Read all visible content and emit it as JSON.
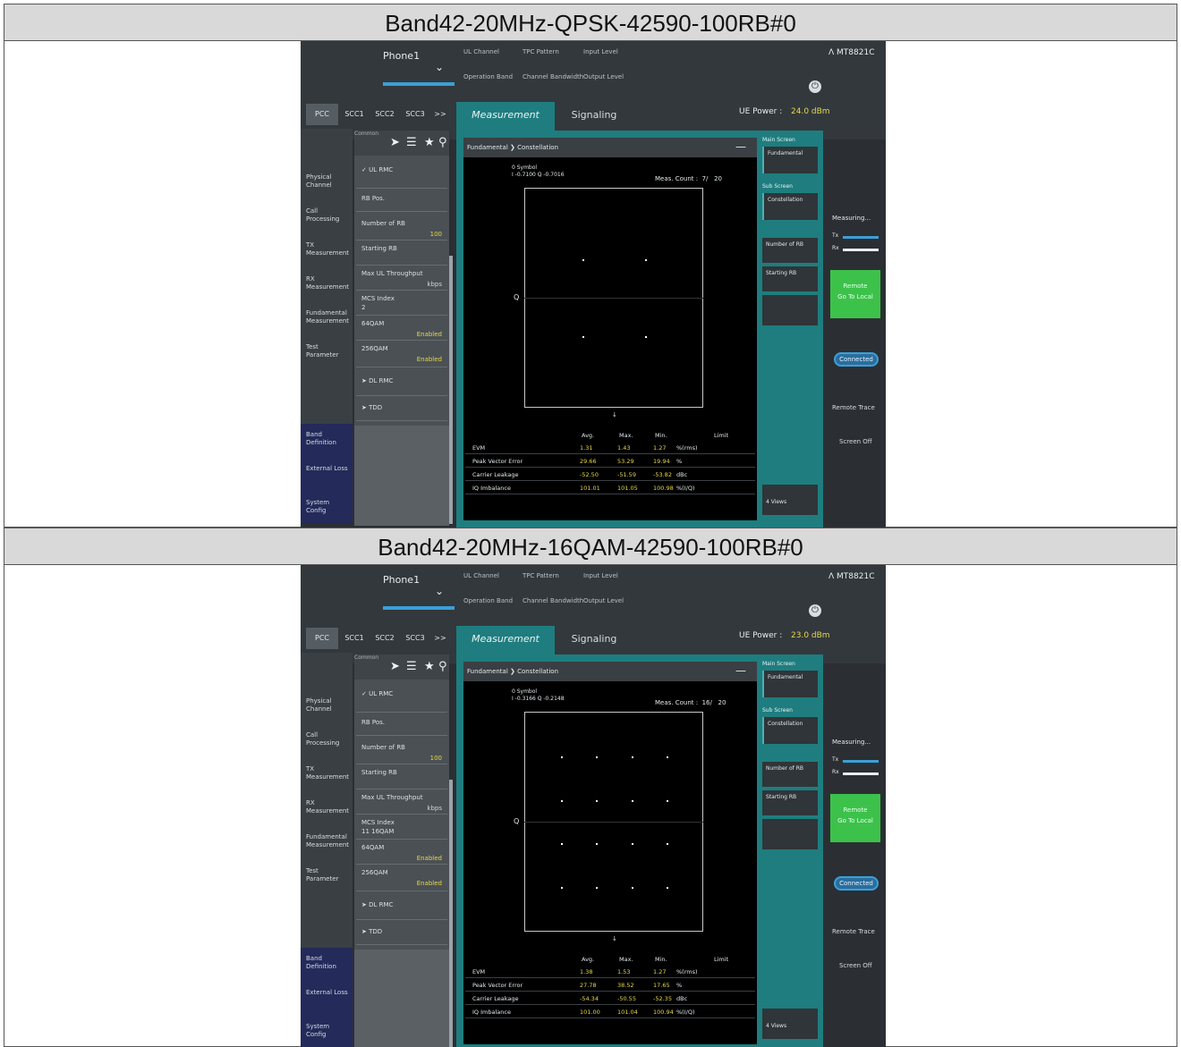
{
  "screens": [
    {
      "header": "Band42-20MHz-QPSK-42590-100RB#0",
      "phone": "Phone1",
      "params": {
        "ul_channel_label": "UL Channel",
        "tpc_pattern_label": "TPC Pattern",
        "input_level_label": "Input Level",
        "operation_band_label": "Operation Band",
        "channel_bandwidth_label": "Channel Bandwidth",
        "output_level_label": "Output Level"
      },
      "brand": "MT8821C",
      "tabs": [
        "PCC",
        "SCC1",
        "SCC2",
        "SCC3",
        ">>"
      ],
      "main_tabs": [
        "Measurement",
        "Signaling"
      ],
      "ue_power_label": "UE Power :",
      "ue_power_value": "24.0 dBm",
      "nav": [
        "Physical Channel",
        "Call Processing",
        "TX Measurement",
        "RX Measurement",
        "Fundamental Measurement",
        "Test Parameter",
        "Band Definition",
        "External Loss",
        "System Config"
      ],
      "common_label": "Common",
      "panel2": {
        "ul_rmc": "UL RMC",
        "rb_pos": "RB Pos.",
        "number_of_rb": "Number of RB",
        "number_of_rb_val": "100",
        "starting_rb": "Starting RB",
        "max_ul_throughput": "Max UL Throughput",
        "throughput_unit": "kbps",
        "mcs_index": "MCS Index",
        "mcs_val": "2",
        "qam64": "64QAM",
        "qam64_val": "Enabled",
        "qam256": "256QAM",
        "qam256_val": "Enabled",
        "dl_rmc": "DL RMC",
        "tdd": "TDD"
      },
      "breadcrumb": [
        "Fundamental",
        "Constellation"
      ],
      "symbol_label": "0 Symbol",
      "symbol_iq": "I -0.7100 Q -0.7016",
      "meas_count_label": "Meas. Count :",
      "meas_count_value": "7/",
      "meas_count_total": "20",
      "axis_q": "Q",
      "table": {
        "headers": [
          "Avg.",
          "Max.",
          "Min.",
          "Limit"
        ],
        "rows": [
          {
            "name": "EVM",
            "avg": "1.31",
            "max": "1.43",
            "min": "1.27",
            "unit": "%(rms)"
          },
          {
            "name": "Peak Vector Error",
            "avg": "29.66",
            "max": "53.29",
            "min": "19.94",
            "unit": "%"
          },
          {
            "name": "Carrier Leakage",
            "avg": "-52.50",
            "max": "-51.59",
            "min": "-53.82",
            "unit": "dBc"
          },
          {
            "name": "IQ Imbalance",
            "avg": "101.01",
            "max": "101.05",
            "min": "100.98",
            "unit": "%(I/Q)"
          }
        ]
      },
      "right_panel": {
        "main_screen": "Main Screen",
        "fundamental": "Fundamental",
        "sub_screen": "Sub Screen",
        "constellation": "Constellation",
        "number_of_rb": "Number of RB",
        "starting_rb": "Starting RB",
        "view_label": "4 Views"
      },
      "far_right": {
        "measuring": "Measuring...",
        "tx": "Tx",
        "rx": "Rx",
        "remote_1": "Remote",
        "remote_2": "Go To Local",
        "connected": "Connected",
        "remote_trace": "Remote Trace",
        "screen_off": "Screen Off"
      },
      "constellation": {
        "type": "scatter",
        "points": [
          [
            -0.707,
            0.707
          ],
          [
            0.707,
            0.707
          ],
          [
            -0.707,
            -0.707
          ],
          [
            0.707,
            -0.707
          ]
        ],
        "xlim": [
          -2,
          2
        ],
        "ylim": [
          -2,
          2
        ]
      }
    },
    {
      "header": "Band42-20MHz-16QAM-42590-100RB#0",
      "phone": "Phone1",
      "params": {
        "ul_channel_label": "UL Channel",
        "tpc_pattern_label": "TPC Pattern",
        "input_level_label": "Input Level",
        "operation_band_label": "Operation Band",
        "channel_bandwidth_label": "Channel Bandwidth",
        "output_level_label": "Output Level"
      },
      "brand": "MT8821C",
      "tabs": [
        "PCC",
        "SCC1",
        "SCC2",
        "SCC3",
        ">>"
      ],
      "main_tabs": [
        "Measurement",
        "Signaling"
      ],
      "ue_power_label": "UE Power :",
      "ue_power_value": "23.0 dBm",
      "nav": [
        "Physical Channel",
        "Call Processing",
        "TX Measurement",
        "RX Measurement",
        "Fundamental Measurement",
        "Test Parameter",
        "Band Definition",
        "External Loss",
        "System Config"
      ],
      "common_label": "Common",
      "panel2": {
        "ul_rmc": "UL RMC",
        "rb_pos": "RB Pos.",
        "number_of_rb": "Number of RB",
        "number_of_rb_val": "100",
        "starting_rb": "Starting RB",
        "max_ul_throughput": "Max UL Throughput",
        "throughput_unit": "kbps",
        "mcs_index": "MCS Index",
        "mcs_val": "11 16QAM",
        "qam64": "64QAM",
        "qam64_val": "Enabled",
        "qam256": "256QAM",
        "qam256_val": "Enabled",
        "dl_rmc": "DL RMC",
        "tdd": "TDD"
      },
      "breadcrumb": [
        "Fundamental",
        "Constellation"
      ],
      "symbol_label": "0 Symbol",
      "symbol_iq": "I -0.3166 Q -0.2148",
      "meas_count_label": "Meas. Count :",
      "meas_count_value": "16/",
      "meas_count_total": "20",
      "axis_q": "Q",
      "table": {
        "headers": [
          "Avg.",
          "Max.",
          "Min.",
          "Limit"
        ],
        "rows": [
          {
            "name": "EVM",
            "avg": "1.38",
            "max": "1.53",
            "min": "1.27",
            "unit": "%(rms)"
          },
          {
            "name": "Peak Vector Error",
            "avg": "27.78",
            "max": "38.52",
            "min": "17.65",
            "unit": "%"
          },
          {
            "name": "Carrier Leakage",
            "avg": "-54.34",
            "max": "-50.55",
            "min": "-52.35",
            "unit": "dBc"
          },
          {
            "name": "IQ Imbalance",
            "avg": "101.00",
            "max": "101.04",
            "min": "100.94",
            "unit": "%(I/Q)"
          }
        ]
      },
      "right_panel": {
        "main_screen": "Main Screen",
        "fundamental": "Fundamental",
        "sub_screen": "Sub Screen",
        "constellation": "Constellation",
        "number_of_rb": "Number of RB",
        "starting_rb": "Starting RB",
        "view_label": "4 Views"
      },
      "far_right": {
        "measuring": "Measuring...",
        "tx": "Tx",
        "rx": "Rx",
        "remote_1": "Remote",
        "remote_2": "Go To Local",
        "connected": "Connected",
        "remote_trace": "Remote Trace",
        "screen_off": "Screen Off"
      },
      "constellation": {
        "type": "scatter",
        "points": [
          [
            -0.949,
            0.949
          ],
          [
            -0.316,
            0.949
          ],
          [
            0.316,
            0.949
          ],
          [
            0.949,
            0.949
          ],
          [
            -0.949,
            0.316
          ],
          [
            -0.316,
            0.316
          ],
          [
            0.316,
            0.316
          ],
          [
            0.949,
            0.316
          ],
          [
            -0.949,
            -0.316
          ],
          [
            -0.316,
            -0.316
          ],
          [
            0.316,
            -0.316
          ],
          [
            0.949,
            -0.316
          ],
          [
            -0.949,
            -0.949
          ],
          [
            -0.316,
            -0.949
          ],
          [
            0.316,
            -0.949
          ],
          [
            0.949,
            -0.949
          ]
        ],
        "xlim": [
          -1.6,
          1.6
        ],
        "ylim": [
          -1.6,
          1.6
        ]
      }
    }
  ]
}
